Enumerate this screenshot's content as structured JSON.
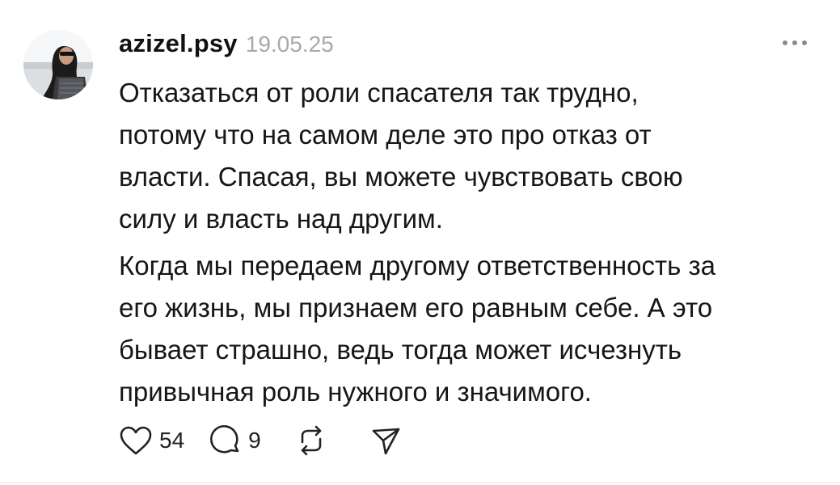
{
  "post": {
    "username": "azizel.psy",
    "timestamp": "19.05.25",
    "paragraphs": [
      {
        "lines": [
          "Отказаться от роли спасателя так трудно,",
          "потому что на самом деле это про отказ от",
          "власти. Спасая, вы можете чувствовать свою",
          "силу и власть над другим."
        ]
      },
      {
        "lines": [
          "Когда мы передаем другому ответственность за",
          "его жизнь, мы признаем его равным себе. А это",
          "бывает страшно, ведь тогда может исчезнуть",
          "привычная роль нужного и значимого."
        ]
      }
    ],
    "actions": {
      "like_count": "54",
      "reply_count": "9"
    },
    "icons": {
      "more": "more-horizontal-icon",
      "like": "heart-icon",
      "reply": "comment-icon",
      "repost": "repost-icon",
      "share": "send-icon"
    },
    "colors": {
      "text": "#161616",
      "timestamp": "#a9a9a9",
      "icon": "#222222"
    }
  }
}
